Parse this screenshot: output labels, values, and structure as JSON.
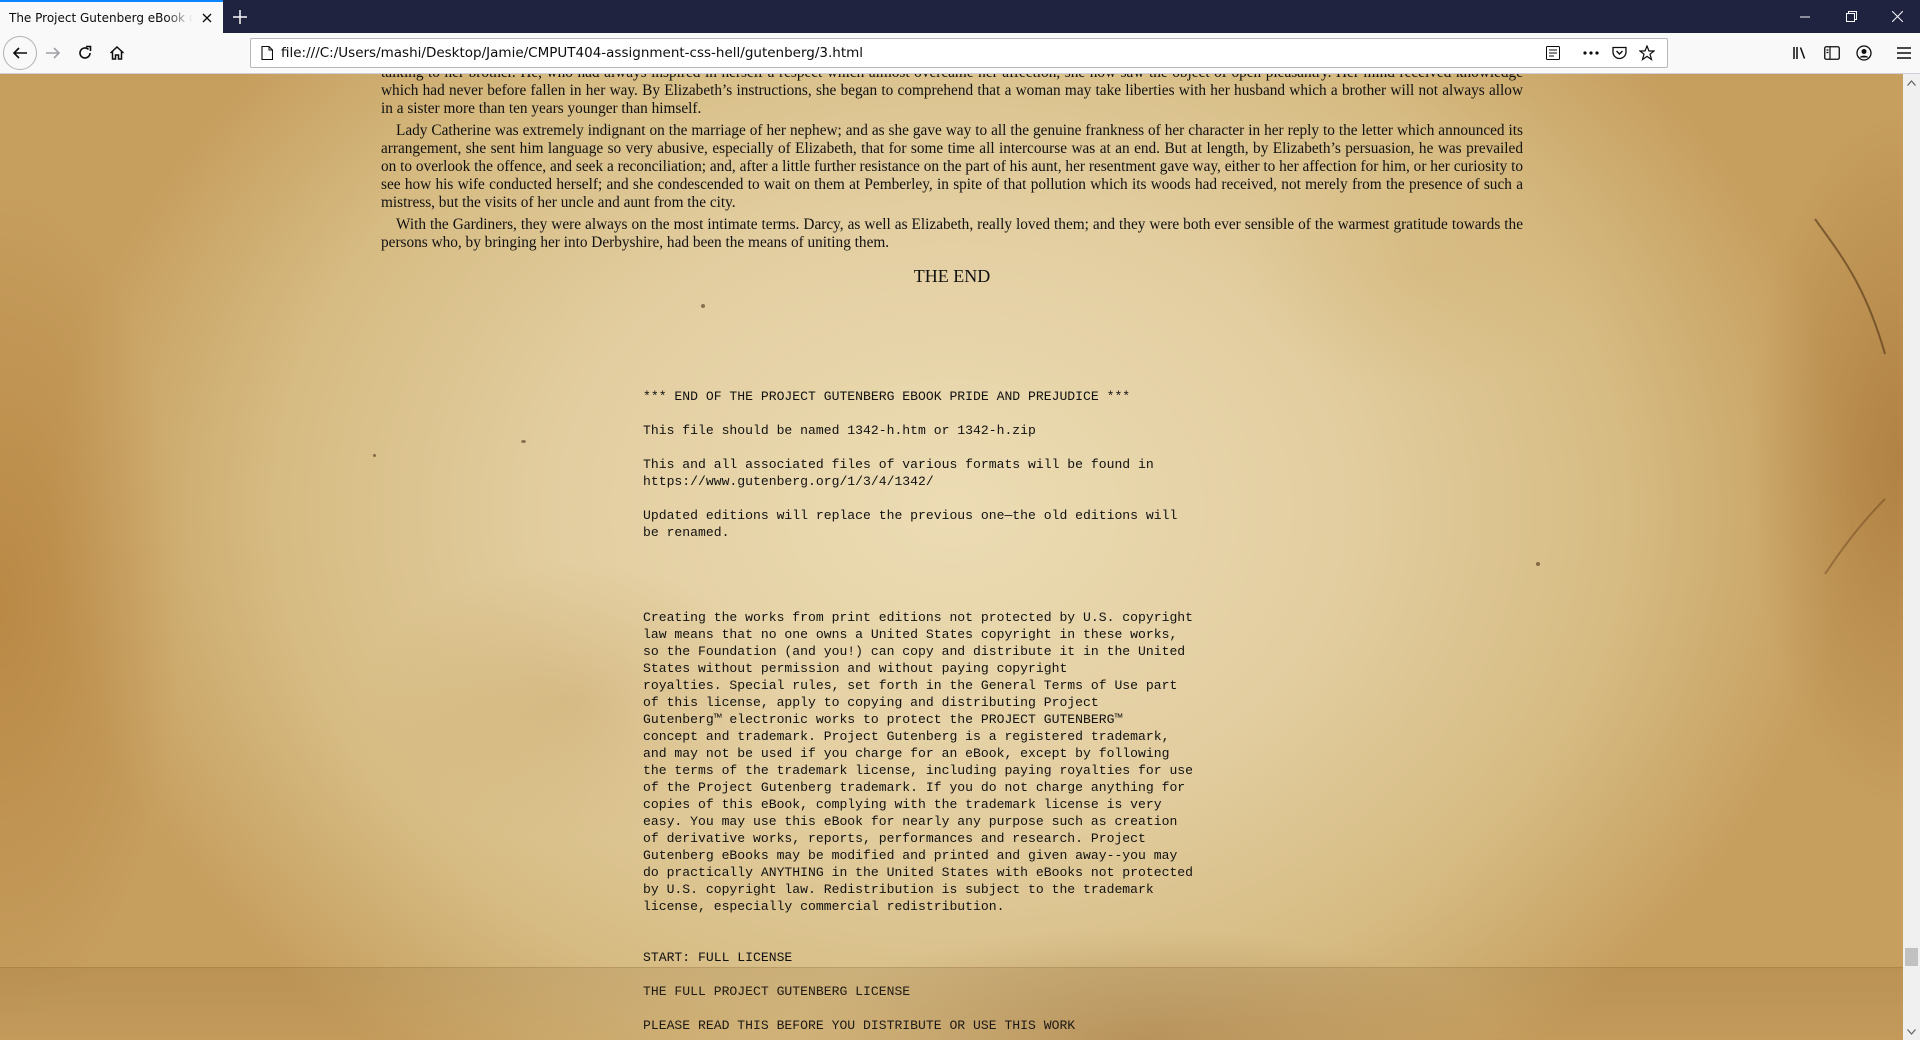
{
  "browser": {
    "tab_title": "The Project Gutenberg eBook of Pride and Prejudice",
    "url": "file:///C:/Users/mashi/Desktop/Jamie/CMPUT404-assignment-css-hell/gutenberg/3.html"
  },
  "book": {
    "para_1": "talking to her brother. He, who had always inspired in herself a respect which almost overcame her affection, she now saw the object of open pleasantry. Her mind received knowledge which had never before fallen in her way. By Elizabeth’s instructions, she began to comprehend that a woman may take liberties with her husband which a brother will not always allow in a sister more than ten years younger than himself.",
    "para_2": "Lady Catherine was extremely indignant on the marriage of her nephew; and as she gave way to all the genuine frankness of her character in her reply to the letter which announced its arrangement, she sent him language so very abusive, especially of Elizabeth, that for some time all intercourse was at an end. But at length, by Elizabeth’s persuasion, he was prevailed on to overlook the offence, and seek a reconciliation; and, after a little further resistance on the part of his aunt, her resentment gave way, either to her affection for him, or her curiosity to see how his wife conducted herself; and she condescended to wait on them at Pemberley, in spite of that pollution which its woods had received, not merely from the presence of such a mistress, but the visits of her uncle and aunt from the city.",
    "para_3": "With the Gardiners, they were always on the most intimate terms. Darcy, as well as Elizabeth, really loved them; and they were both ever sensible of the warmest gratitude towards the persons who, by bringing her into Derbyshire, had been the means of uniting them.",
    "the_end": "THE END"
  },
  "license": {
    "end_marker": "*** END OF THE PROJECT GUTENBERG EBOOK PRIDE AND PREJUDICE ***",
    "file_named": "This file should be named 1342-h.htm or 1342-h.zip",
    "found_in": "This and all associated files of various formats will be found in\nhttps://www.gutenberg.org/1/3/4/1342/",
    "updated": "Updated editions will replace the previous one—the old editions will\nbe renamed.",
    "creating": "Creating the works from print editions not protected by U.S. copyright\nlaw means that no one owns a United States copyright in these works,\nso the Foundation (and you!) can copy and distribute it in the United\nStates without permission and without paying copyright\nroyalties. Special rules, set forth in the General Terms of Use part\nof this license, apply to copying and distributing Project\nGutenberg™ electronic works to protect the PROJECT GUTENBERG™\nconcept and trademark. Project Gutenberg is a registered trademark,\nand may not be used if you charge for an eBook, except by following\nthe terms of the trademark license, including paying royalties for use\nof the Project Gutenberg trademark. If you do not charge anything for\ncopies of this eBook, complying with the trademark license is very\neasy. You may use this eBook for nearly any purpose such as creation\nof derivative works, reports, performances and research. Project\nGutenberg eBooks may be modified and printed and given away--you may\ndo practically ANYTHING in the United States with eBooks not protected\nby U.S. copyright law. Redistribution is subject to the trademark\nlicense, especially commercial redistribution.",
    "start_full": "START: FULL LICENSE",
    "full_license": "THE FULL PROJECT GUTENBERG LICENSE",
    "please_read": "PLEASE READ THIS BEFORE YOU DISTRIBUTE OR USE THIS WORK"
  },
  "icons": {
    "tab_close": "close-icon",
    "new_tab": "plus-icon",
    "back": "arrow-left-icon",
    "forward": "arrow-right-icon",
    "reload": "reload-icon",
    "home": "home-icon",
    "page": "page-icon",
    "reader": "reader-view-icon",
    "more": "more-dots-icon",
    "pocket": "pocket-icon",
    "bookmark": "star-icon",
    "library": "library-icon",
    "sidebar": "sidebar-icon",
    "account": "account-icon",
    "menu": "hamburger-icon"
  },
  "colors": {
    "tabstrip": "#202340",
    "active_tab_accent": "#0a84ff",
    "paper": "#e2cd9f"
  }
}
